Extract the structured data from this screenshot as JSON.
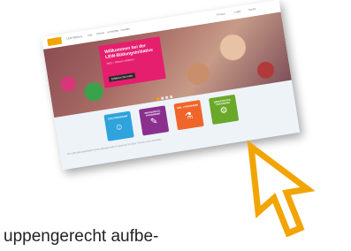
{
  "site": {
    "nav": [
      "LEW-Bildung",
      "Kita",
      "Schule",
      "Lehrkräfte",
      "Kontakt"
    ],
    "util": [
      "Presse",
      "Login",
      "Suche"
    ]
  },
  "hero": {
    "title": "Willkommen bei der LEW-Bildungsinitiative",
    "subtitle": "Jetzt – Wissen erfahren.",
    "button": "Erfahren Sie mehr"
  },
  "tiles": [
    {
      "label": "KITA PROGRAMM",
      "icon": "☺",
      "color": "#2ea3dc"
    },
    {
      "label": "GRUNDSCHUL PROGRAMM",
      "icon": "✎",
      "color": "#8a2f8e"
    },
    {
      "label": "SEK. I PROGRAMM",
      "icon": "⚗",
      "color": "#f0652a"
    },
    {
      "label": "BERUFSSCHUL PROGRAMM",
      "icon": "⚙",
      "color": "#6aa82a"
    }
  ],
  "footer_text": "Die LEW-Bildungsinitiative bietet altersgerechte Programme für Kitas, Schulen und Lehrkräfte.",
  "caption": "uppengerecht aufbe-",
  "colors": {
    "accent": "#f2a400",
    "hero_box": "#e61e6e"
  }
}
